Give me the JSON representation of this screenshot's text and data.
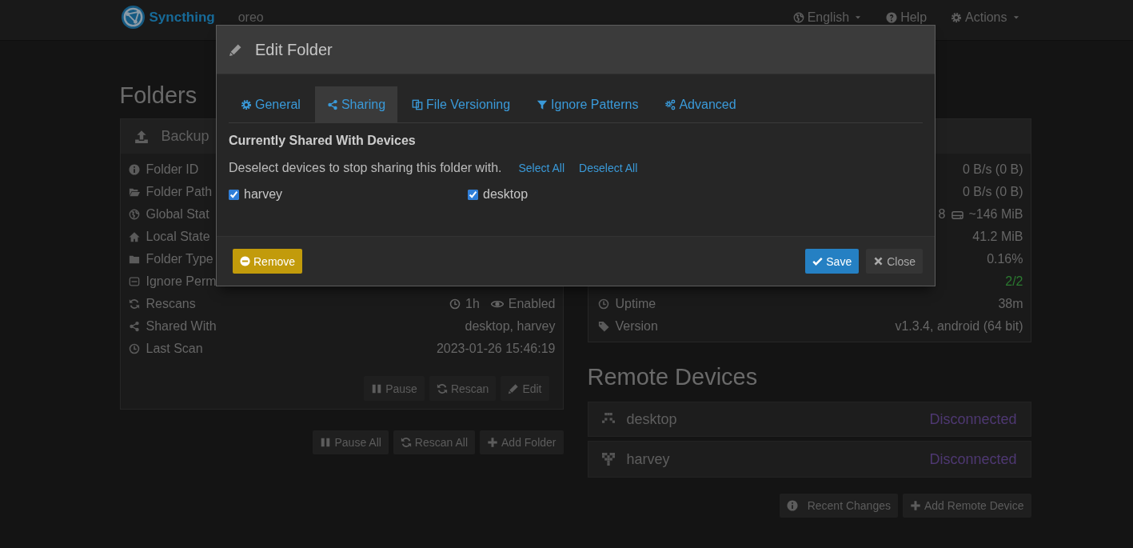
{
  "navbar": {
    "brand": "Syncthing",
    "device_name": "oreo",
    "menu": [
      {
        "label": "English",
        "kind": "dropdown"
      },
      {
        "label": "Help",
        "kind": "link"
      },
      {
        "label": "Actions",
        "kind": "dropdown"
      }
    ]
  },
  "folders": {
    "title": "Folders",
    "folder": {
      "name": "Backup",
      "rows": [
        {
          "label": "Folder ID",
          "kind": "label"
        },
        {
          "label": "Folder Path",
          "kind": "label"
        },
        {
          "label": "Global Stat",
          "kind": "label"
        },
        {
          "label": "Local State",
          "kind": "label"
        },
        {
          "label": "Folder Type",
          "kind": "label"
        },
        {
          "label": "Ignore Perm",
          "kind": "label"
        },
        {
          "label": "Rescans",
          "kind": "rescan",
          "interval": "1h",
          "watcher": "Enabled"
        },
        {
          "label": "Shared With",
          "kind": "text",
          "value": "desktop, harvey"
        },
        {
          "label": "Last Scan",
          "kind": "text",
          "value": "2023-01-26 15:46:19"
        }
      ],
      "buttons": [
        "Pause",
        "Rescan",
        "Edit"
      ]
    },
    "buttons": [
      "Pause All",
      "Rescan All",
      "Add Folder"
    ]
  },
  "this_device": {
    "rows": [
      {
        "kind": "text",
        "value": "0 B/s (0 B)",
        "highlight": false
      },
      {
        "kind": "text",
        "value": "0 B/s (0 B)",
        "highlight": false
      },
      {
        "kind": "size",
        "value": "8",
        "size": "~146 MiB",
        "highlight": false
      },
      {
        "kind": "text",
        "value": "41.2 MiB",
        "highlight": false
      },
      {
        "kind": "text",
        "value": "0.16%",
        "highlight": false
      },
      {
        "kind": "text",
        "value": "2/2",
        "highlight": true
      },
      {
        "kind": "text",
        "label": "Uptime",
        "value": "38m",
        "highlight": false
      },
      {
        "kind": "text",
        "label": "Version",
        "value": "v1.3.4, android (64 bit)",
        "highlight": false
      }
    ]
  },
  "remote_devices": {
    "title": "Remote Devices",
    "devices": [
      {
        "name": "desktop",
        "status": "Disconnected"
      },
      {
        "name": "harvey",
        "status": "Disconnected"
      }
    ],
    "buttons": [
      "Recent Changes",
      "Add Remote Device"
    ]
  },
  "modal": {
    "title": "Edit Folder",
    "tabs": [
      {
        "label": "General",
        "selected": false
      },
      {
        "label": "Sharing",
        "selected": true
      },
      {
        "label": "File Versioning",
        "selected": false
      },
      {
        "label": "Ignore Patterns",
        "selected": false
      },
      {
        "label": "Advanced",
        "selected": false
      }
    ],
    "section_title": "Currently Shared With Devices",
    "hint": "Deselect devices to stop sharing this folder with.",
    "links": [
      "Select All",
      "Deselect All"
    ],
    "devices": [
      {
        "name": "harvey",
        "checked": true
      },
      {
        "name": "desktop",
        "checked": true
      }
    ],
    "buttons": [
      {
        "label": "Remove",
        "kind": "danger"
      },
      {
        "label": "Save",
        "kind": "primary"
      },
      {
        "label": "Close",
        "kind": "default"
      }
    ]
  }
}
